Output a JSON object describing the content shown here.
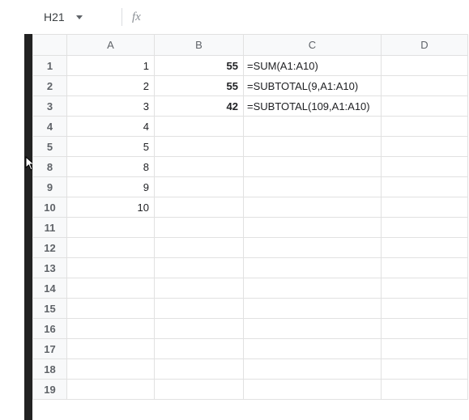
{
  "namebox": {
    "cell": "H21",
    "fx_label": "fx"
  },
  "columns": [
    "A",
    "B",
    "C",
    "D"
  ],
  "rows": [
    {
      "n": "1",
      "A": "1",
      "B": "55",
      "C": "=SUM(A1:A10)"
    },
    {
      "n": "2",
      "A": "2",
      "B": "55",
      "C": "=SUBTOTAL(9,A1:A10)"
    },
    {
      "n": "3",
      "A": "3",
      "B": "42",
      "C": "=SUBTOTAL(109,A1:A10)"
    },
    {
      "n": "4",
      "A": "4",
      "B": "",
      "C": ""
    },
    {
      "n": "5",
      "A": "5",
      "B": "",
      "C": ""
    },
    {
      "n": "8",
      "A": "8",
      "B": "",
      "C": ""
    },
    {
      "n": "9",
      "A": "9",
      "B": "",
      "C": ""
    },
    {
      "n": "10",
      "A": "10",
      "B": "",
      "C": ""
    },
    {
      "n": "11",
      "A": "",
      "B": "",
      "C": ""
    },
    {
      "n": "12",
      "A": "",
      "B": "",
      "C": ""
    },
    {
      "n": "13",
      "A": "",
      "B": "",
      "C": ""
    },
    {
      "n": "14",
      "A": "",
      "B": "",
      "C": ""
    },
    {
      "n": "15",
      "A": "",
      "B": "",
      "C": ""
    },
    {
      "n": "16",
      "A": "",
      "B": "",
      "C": ""
    },
    {
      "n": "17",
      "A": "",
      "B": "",
      "C": ""
    },
    {
      "n": "18",
      "A": "",
      "B": "",
      "C": ""
    },
    {
      "n": "19",
      "A": "",
      "B": "",
      "C": ""
    }
  ]
}
